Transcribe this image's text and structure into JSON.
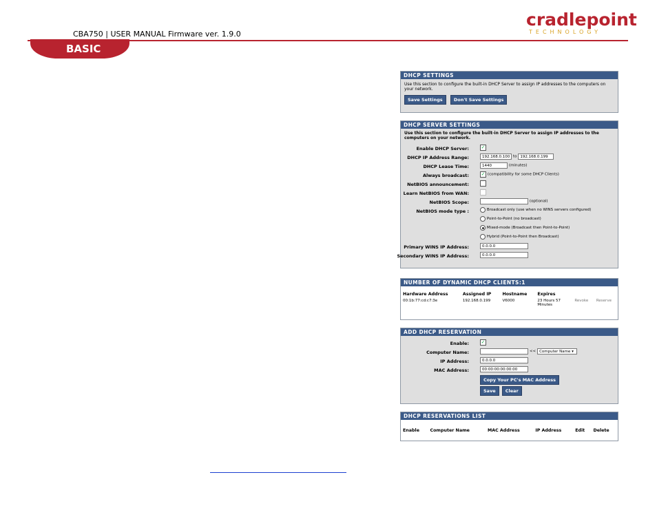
{
  "header": {
    "doc_title": "CBA750 | USER MANUAL Firmware ver. 1.9.0",
    "logo_text": "cradlepoint",
    "logo_sub": "TECHNOLOGY",
    "section_tab": "BASIC"
  },
  "dhcp_settings": {
    "title": "DHCP SETTINGS",
    "description": "Use this section to configure the built-in DHCP Server to assign IP addresses to the computers on your network.",
    "save_label": "Save Settings",
    "dont_save_label": "Don't Save Settings"
  },
  "server": {
    "title": "DHCP SERVER SETTINGS",
    "description": "Use this section to configure the built-in DHCP Server to assign IP addresses to the computers on your network.",
    "enable_label": "Enable DHCP Server:",
    "range_label": "DHCP IP Address Range:",
    "range_start": "192.168.0.100",
    "range_to": "to",
    "range_end": "192.168.0.199",
    "lease_label": "DHCP Lease Time:",
    "lease_value": "1440",
    "lease_unit": "(minutes)",
    "always_label": "Always broadcast:",
    "always_note": "(compatibility for some DHCP Clients)",
    "netbios_ann_label": "NetBIOS announcement:",
    "learn_label": "Learn NetBIOS from WAN:",
    "scope_label": "NetBIOS Scope:",
    "scope_note": "(optional)",
    "mode_label": "NetBIOS mode type :",
    "mode_opts": [
      "Broadcast only (use when no WINS servers configured)",
      "Point-to-Point (no broadcast)",
      "Mixed-mode (Broadcast then Point-to-Point)",
      "Hybrid (Point-to-Point then Broadcast)"
    ],
    "primary_wins_label": "Primary WINS IP Address:",
    "primary_wins": "0.0.0.0",
    "secondary_wins_label": "Secondary WINS IP Address:",
    "secondary_wins": "0.0.0.0"
  },
  "clients": {
    "title": "NUMBER OF DYNAMIC DHCP CLIENTS:1",
    "headers": [
      "Hardware Address",
      "Assigned IP",
      "Hostname",
      "Expires"
    ],
    "row": {
      "hw": "00:1b:77:cd:c7:3e",
      "ip": "192.168.0.199",
      "host": "V6000",
      "expires": "23 Hours 57 Minutes",
      "revoke": "Revoke",
      "reserve": "Reserve"
    }
  },
  "reservation": {
    "title": "ADD DHCP RESERVATION",
    "enable_label": "Enable:",
    "computer_label": "Computer Name:",
    "computer_select": "Computer Name",
    "ip_label": "IP Address:",
    "ip_value": "0.0.0.0",
    "mac_label": "MAC Address:",
    "mac_value": "00:00:00:00:00:00",
    "copy_label": "Copy Your PC's MAC Address",
    "save_label": "Save",
    "clear_label": "Clear"
  },
  "res_list": {
    "title": "DHCP RESERVATIONS LIST",
    "headers": [
      "Enable",
      "Computer Name",
      "MAC Address",
      "IP Address",
      "Edit",
      "Delete"
    ]
  },
  "colors": {
    "brand": "#b8232f",
    "panel_header": "#3b5a88",
    "panel_bg": "#dfdfdf"
  }
}
